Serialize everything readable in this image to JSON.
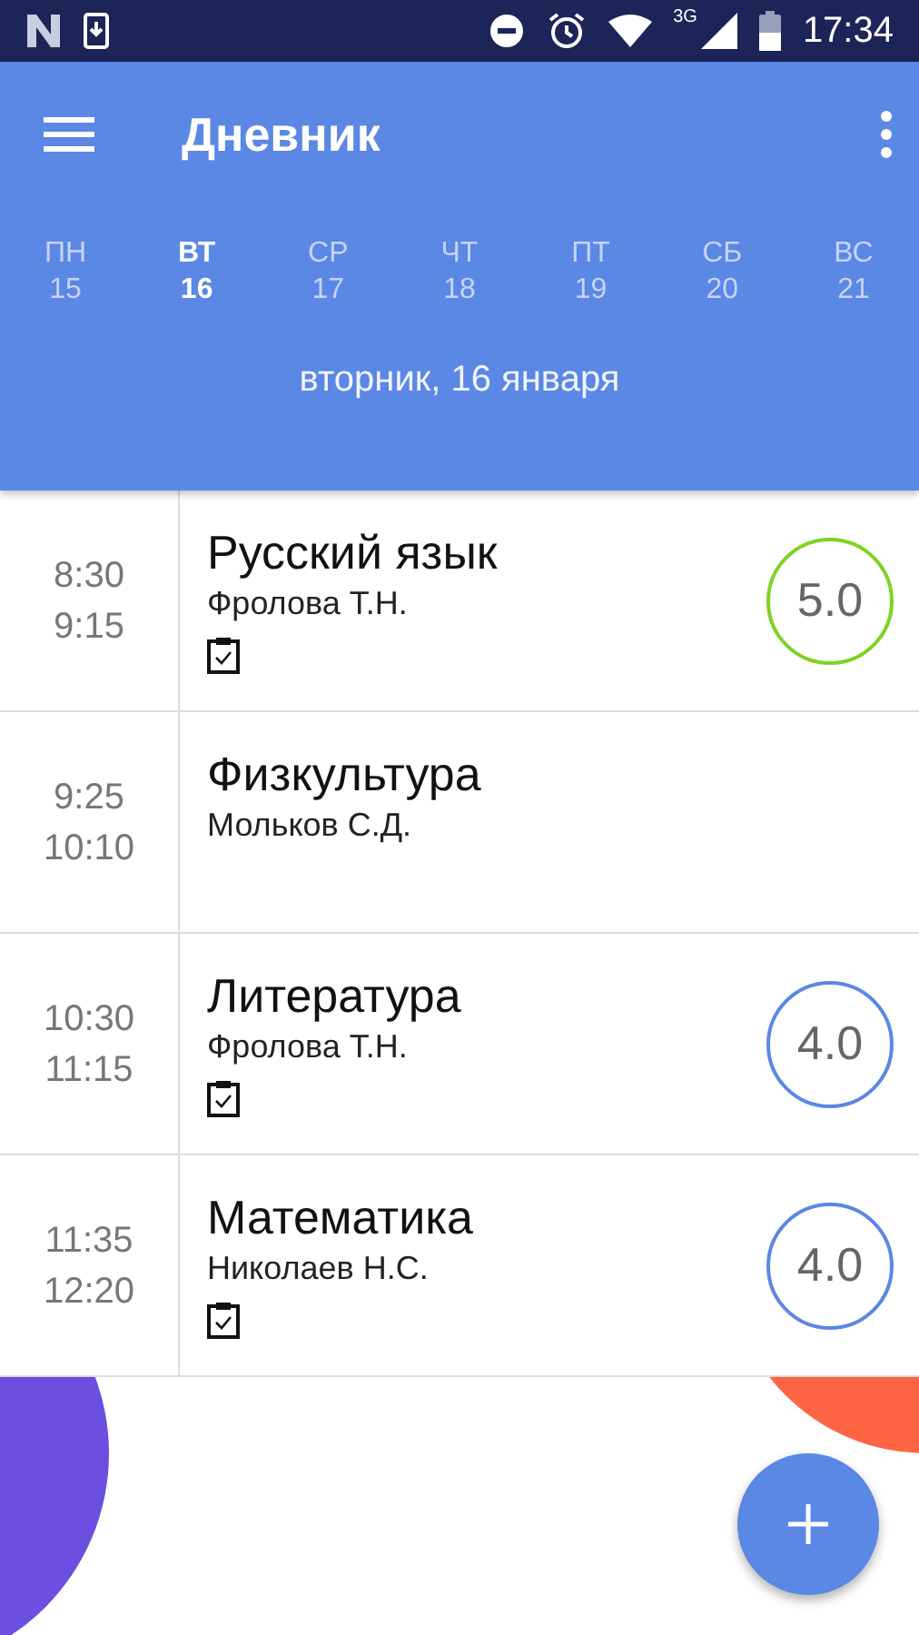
{
  "status_bar": {
    "network": "3G",
    "time": "17:34"
  },
  "app_bar": {
    "title": "Дневник"
  },
  "days": [
    {
      "weekday": "ПН",
      "date": "15",
      "selected": false
    },
    {
      "weekday": "ВТ",
      "date": "16",
      "selected": true
    },
    {
      "weekday": "СР",
      "date": "17",
      "selected": false
    },
    {
      "weekday": "ЧТ",
      "date": "18",
      "selected": false
    },
    {
      "weekday": "ПТ",
      "date": "19",
      "selected": false
    },
    {
      "weekday": "СБ",
      "date": "20",
      "selected": false
    },
    {
      "weekday": "ВС",
      "date": "21",
      "selected": false
    }
  ],
  "selected_date": "вторник, 16 января",
  "lessons": [
    {
      "start": "8:30",
      "end": "9:15",
      "subject": "Русский язык",
      "teacher": "Фролова Т.Н.",
      "homework": true,
      "grade": "5.0",
      "color": "#7ed321"
    },
    {
      "start": "9:25",
      "end": "10:10",
      "subject": "Физкультура",
      "teacher": "Мольков С.Д.",
      "homework": false
    },
    {
      "start": "10:30",
      "end": "11:15",
      "subject": "Литература",
      "teacher": "Фролова Т.Н.",
      "homework": true,
      "grade": "4.0",
      "color": "#5b87e5"
    },
    {
      "start": "11:35",
      "end": "12:20",
      "subject": "Математика",
      "teacher": "Николаев Н.С.",
      "homework": true,
      "grade": "4.0",
      "color": "#5b87e5"
    }
  ]
}
